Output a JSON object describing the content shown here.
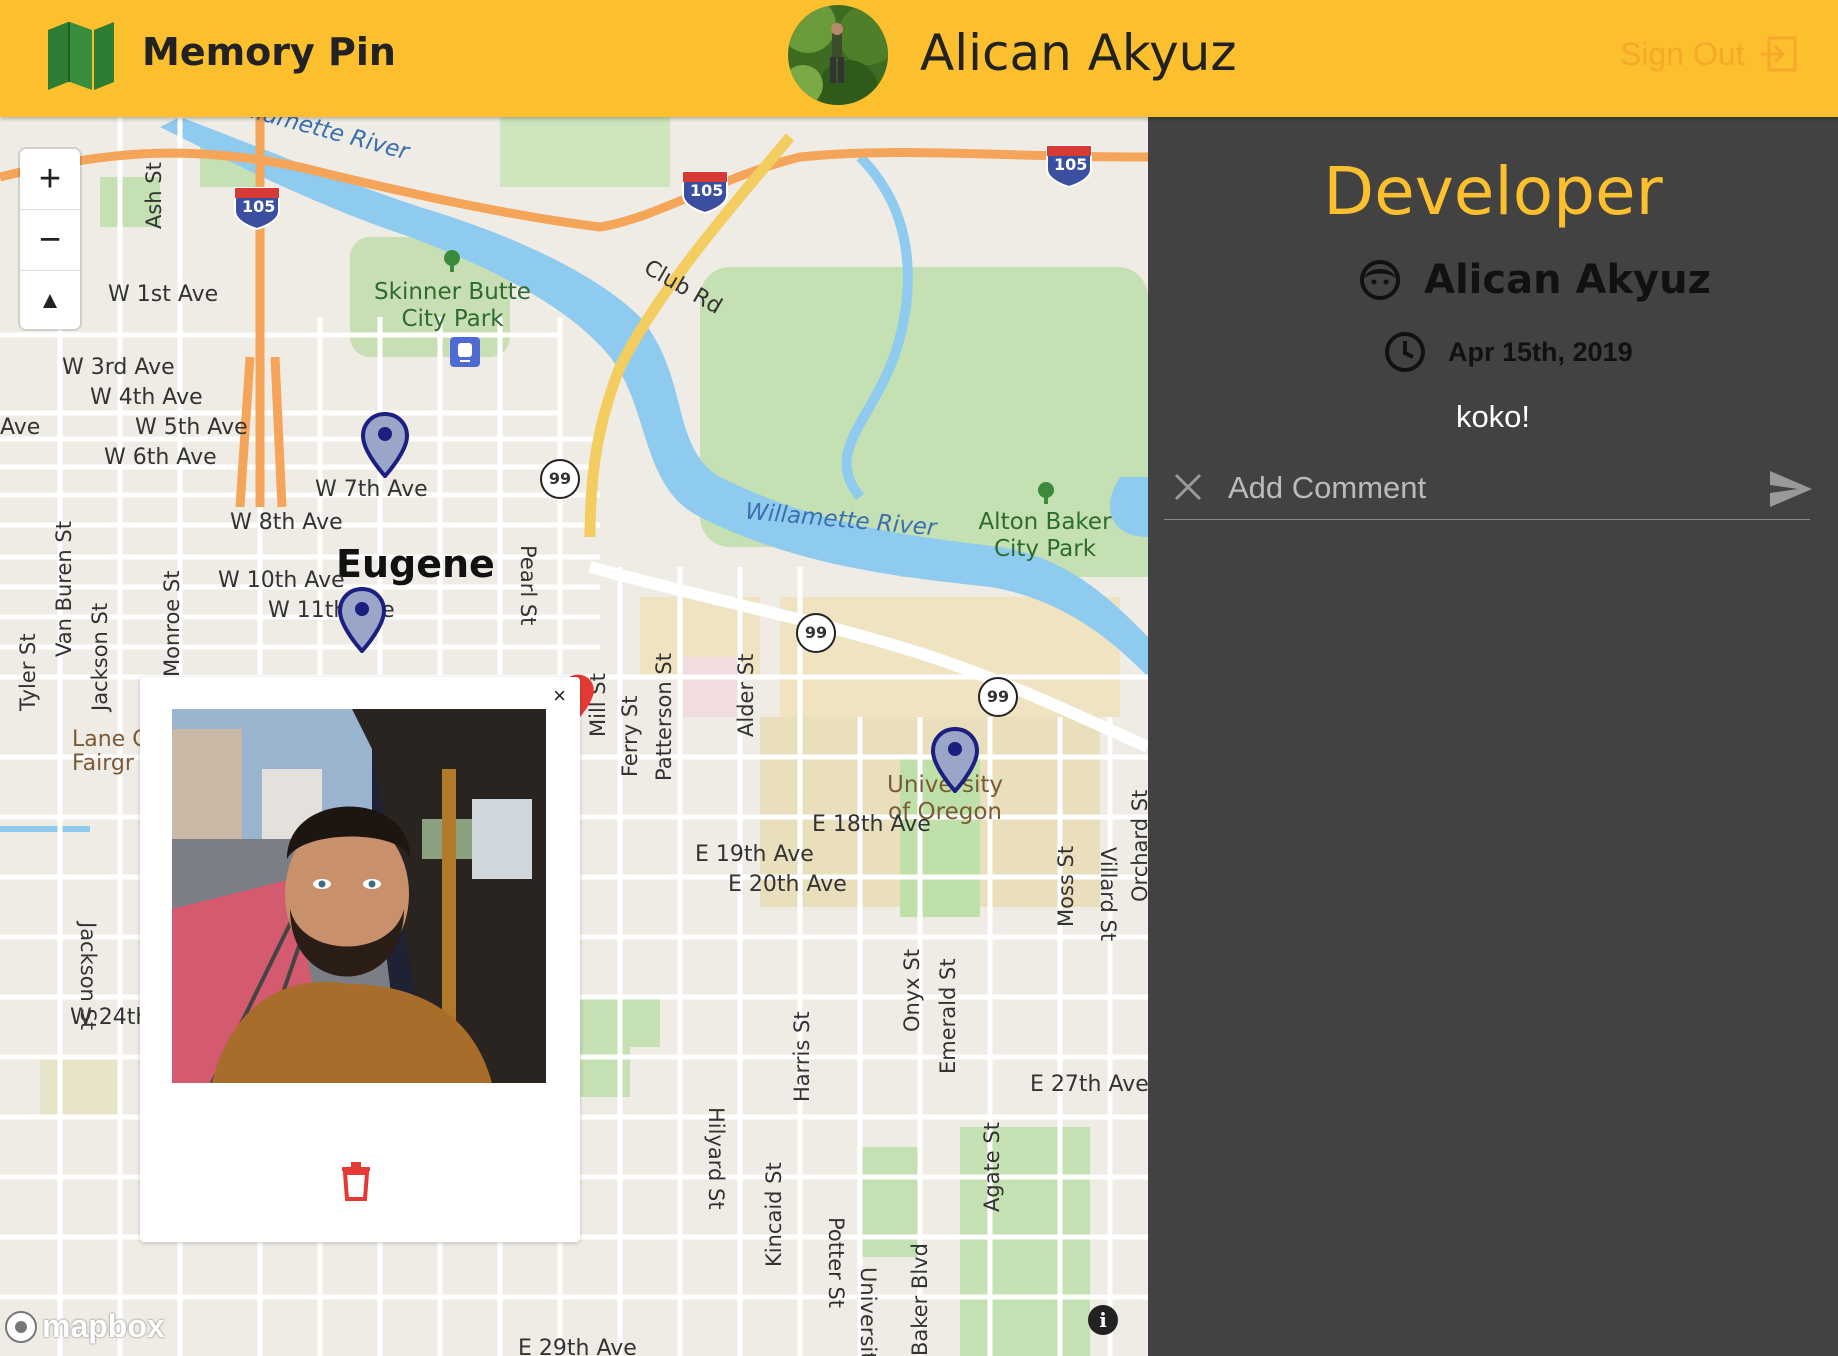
{
  "header": {
    "app_title": "Memory Pin",
    "logo_icon": "map-icon",
    "user_name": "Alican Akyuz",
    "sign_out_label": "Sign Out",
    "sign_out_icon": "exit-icon",
    "brand_color": "#fcbf2e"
  },
  "map": {
    "zoom_in_label": "+",
    "zoom_out_label": "−",
    "compass_label": "▲",
    "city": "Eugene",
    "streets": [
      "W 1st Ave",
      "W 3rd Ave",
      "W 4th Ave",
      "W 5th Ave",
      "W 6th Ave",
      "W 7th Ave",
      "W 8th Ave",
      "W 10th Ave",
      "W 11th Ave",
      "W 24th",
      "E 18th Ave",
      "E 19th Ave",
      "E 20th Ave",
      "E 27th Ave",
      "E 29th Ave",
      "Club Rd",
      "Ash St",
      "Van Buren St",
      "Jackson St",
      "Tyler St",
      "Monroe St",
      "Pearl St",
      "Mill St",
      "Ferry St",
      "Patterson St",
      "Alder St",
      "Moss St",
      "Villard St",
      "Orchard St",
      "Harris St",
      "Onyx St",
      "Emerald St",
      "Hilyard St",
      "Kincaid St",
      "Potter St",
      "University",
      "Baker Blvd",
      "Agate St",
      "Ave",
      "Lane C",
      "Fairgr"
    ],
    "parks": [
      "Skinner Butte City Park",
      "Alton Baker City Park",
      "University of Oregon"
    ],
    "rivers": [
      "Willamette River",
      "Willamette River"
    ],
    "highways": [
      "105",
      "105",
      "105",
      "99",
      "99",
      "99"
    ],
    "attribution": "mapbox",
    "info_label": "i",
    "popup": {
      "close_label": "×",
      "photo_alt": "Memory photo",
      "delete_icon": "trash-icon"
    }
  },
  "panel": {
    "title": "Developer",
    "author": "Alican Akyuz",
    "author_icon": "face-icon",
    "date": "Apr 15th, 2019",
    "date_icon": "clock-icon",
    "text": "koko!",
    "comment_placeholder": "Add Comment",
    "clear_icon": "close-icon",
    "send_icon": "send-icon"
  }
}
